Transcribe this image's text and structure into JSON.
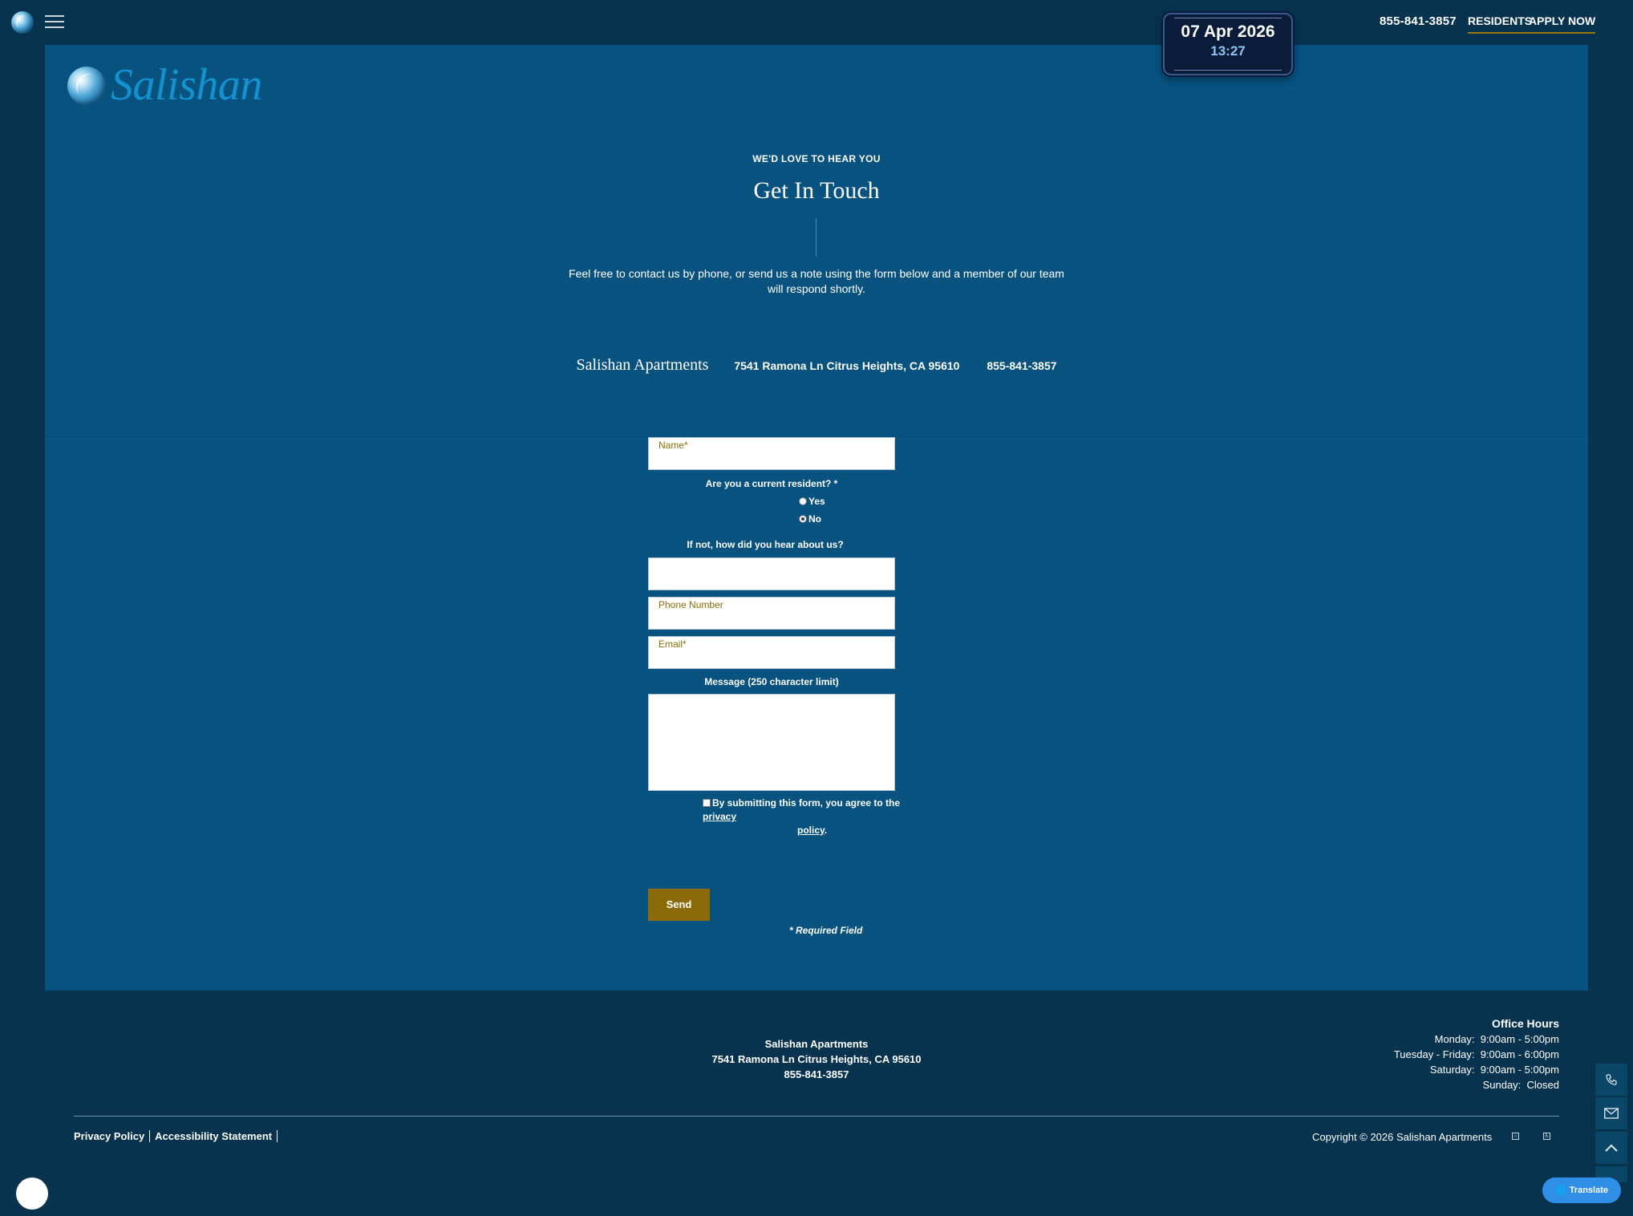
{
  "topbar": {
    "phone": "855-841-3857",
    "residents": "RESIDENTS",
    "apply": "APPLY NOW"
  },
  "clock": {
    "date": "07 Apr 2026",
    "time": "13:27"
  },
  "logo": {
    "text": "Salishan"
  },
  "hero": {
    "eyebrow": "WE'D LOVE TO HEAR YOU",
    "title": "Get In Touch",
    "intro": "Feel free to contact us by phone, or send us a note using the form below and a member of our team will respond shortly."
  },
  "contact": {
    "name": "Salishan Apartments",
    "address": "7541 Ramona Ln Citrus Heights, CA 95610",
    "phone": "855-841-3857"
  },
  "form": {
    "name_label": "Name*",
    "resident_question": "Are you a current resident? *",
    "option_yes": "Yes",
    "option_no": "No",
    "selected_option": "No",
    "hear_question": "If not, how did you hear about us?",
    "hear_value": "",
    "phone_label": "Phone Number",
    "email_label": "Email*",
    "message_label": "Message (250 character limit)",
    "message_value": "",
    "agree_text": "By submitting this form, you agree to the",
    "privacy_link_1": "privacy",
    "privacy_link_2": "policy",
    "agree_end": ".",
    "send": "Send",
    "required_note": "* Required Field"
  },
  "footer": {
    "name": "Salishan Apartments",
    "address": "7541 Ramona Ln Citrus Heights, CA 95610",
    "phone": "855-841-3857",
    "hours_title": "Office Hours",
    "hours": [
      {
        "day": "Monday:",
        "time": "9:00am - 5:00pm"
      },
      {
        "day": "Tuesday - Friday:",
        "time": "9:00am - 6:00pm"
      },
      {
        "day": "Saturday:",
        "time": "9:00am - 5:00pm"
      },
      {
        "day": "Sunday:",
        "time": "Closed"
      }
    ],
    "privacy": "Privacy Policy",
    "accessibility": "Accessibility Statement",
    "copyright": "Copyright © 2026 Salishan Apartments",
    "translate": "Translate"
  },
  "icons": {
    "menu": "hamburger-menu-icon",
    "phone": "phone-icon",
    "mail": "envelope-icon",
    "up": "chevron-up-icon",
    "globe": "globe-icon"
  },
  "colors": {
    "page_bg": "#07334f",
    "panel_bg": "#07527f",
    "accent_gold": "#8b6a0a",
    "logo_blue": "#1492d0",
    "translate_blue": "#2f8fe6"
  }
}
